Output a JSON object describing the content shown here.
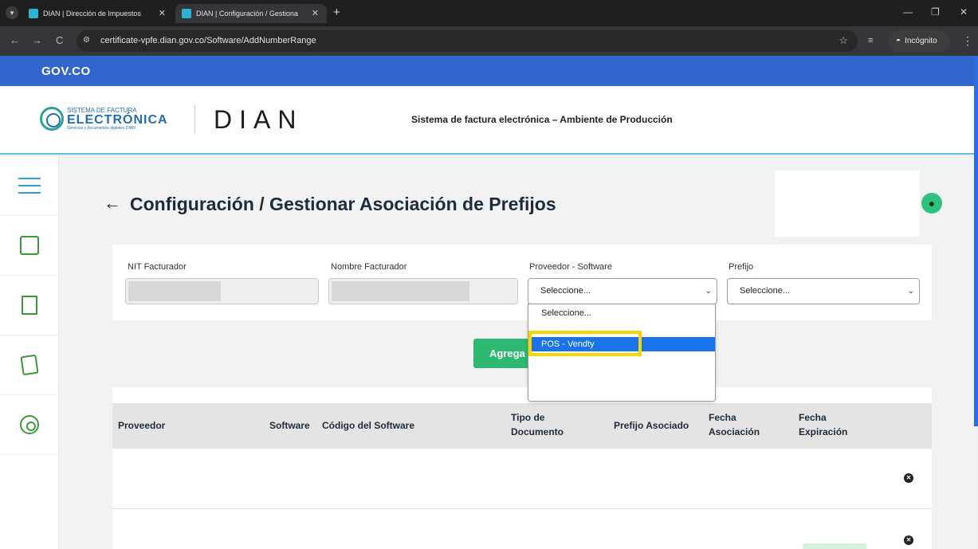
{
  "browser": {
    "tabs": [
      {
        "title": "DIAN | Dirección de Impuestos",
        "close": "✕"
      },
      {
        "title": "DIAN | Configuración / Gestiona",
        "close": "✕"
      }
    ],
    "new_tab": "+",
    "url": "certificate-vpfe.dian.gov.co/Software/AddNumberRange",
    "incognito_label": "Incógnito",
    "window_controls": {
      "minimize": "—",
      "restore": "❐",
      "close": "✕"
    },
    "nav": {
      "back": "←",
      "forward": "→",
      "reload": "C"
    }
  },
  "gov_bar": {
    "logo": "GOV.CO"
  },
  "header": {
    "brand_line1": "SISTEMA DE FACTURA",
    "brand_line2": "ELECTRÓNICA",
    "brand_line3": "Servicios y documentos digitales DIAN",
    "dian_logo": "DIAN",
    "environment": "Sistema de factura electrónica – Ambiente de Producción"
  },
  "sidebar": {
    "items": [
      "menu-icon",
      "monitor-icon",
      "document-icon",
      "edit-document-icon",
      "settings-icon"
    ]
  },
  "main": {
    "back": "←",
    "title": "Configuración / Gestionar Asociación de Prefijos",
    "form": {
      "nit_label": "NIT Facturador",
      "nombre_label": "Nombre Facturador",
      "proveedor_label": "Proveedor - Software",
      "proveedor_value": "Seleccione...",
      "prefijo_label": "Prefijo",
      "prefijo_value": "Seleccione..."
    },
    "add_button": "Agrega",
    "table": {
      "headers": [
        "Proveedor",
        "Software",
        "Código del Software",
        "Tipo de\nDocumento",
        "Prefijo Asociado",
        "Fecha\nAsociación",
        "Fecha\nExpiración"
      ]
    }
  },
  "dropdown": {
    "options": [
      "Seleccione...",
      "POS - Vendty"
    ],
    "selected_index": 1
  },
  "colors": {
    "gov_blue": "#3366cc",
    "accent_green": "#2eb872",
    "highlight_yellow": "#f5d800",
    "select_blue": "#1a73e8"
  }
}
